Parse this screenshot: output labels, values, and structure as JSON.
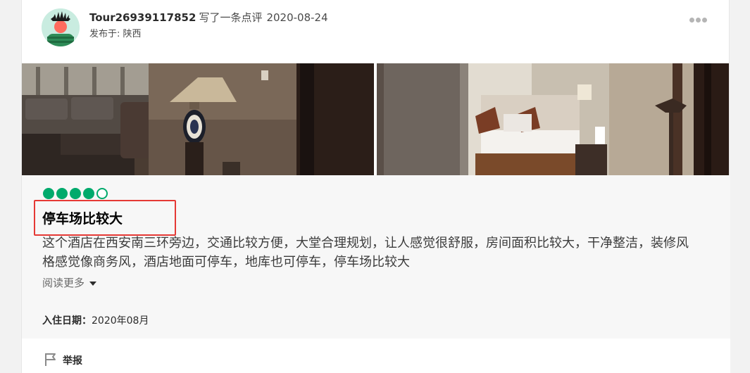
{
  "review": {
    "username": "Tour26939117852",
    "action": "写了一条点评",
    "date": "2020-08-24",
    "location": "发布于: 陕西",
    "rating": 4,
    "rating_max": 5,
    "title": "停车场比较大",
    "text": "这个酒店在西安南三环旁边，交通比较方便，大堂合理规划，让人感觉很舒服，房间面积比较大，干净整洁，装修风格感觉像商务风，酒店地面可停车，地库也可停车，停车场比较大",
    "read_more": "阅读更多",
    "stay_label": "入住日期：",
    "stay_value": "2020年08月",
    "report_label": "举报"
  },
  "icons": {
    "more": "more-dots-icon",
    "flag": "flag-icon",
    "chevron": "chevron-down-icon"
  },
  "colors": {
    "bubble": "#00aa6c",
    "highlight": "#e53935"
  }
}
